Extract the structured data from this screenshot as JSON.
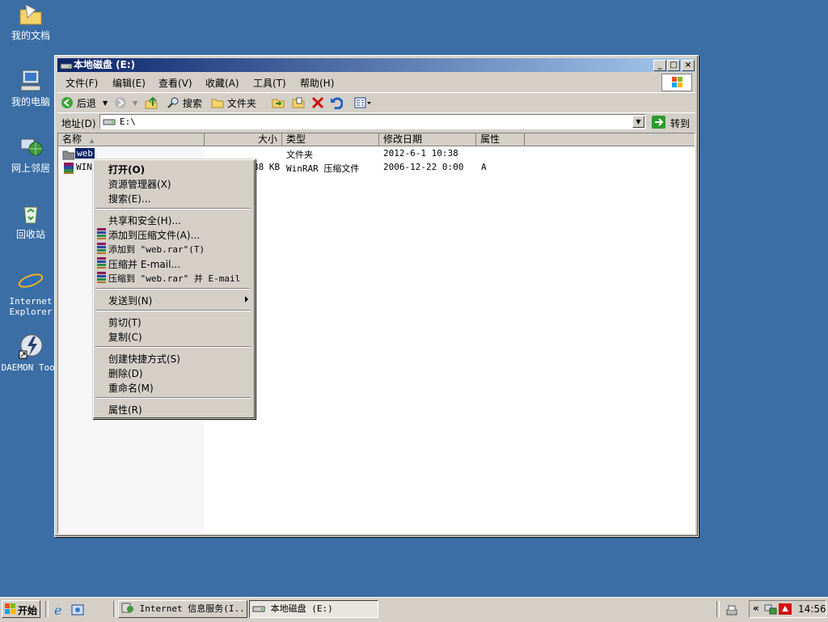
{
  "desktop": {
    "icons": [
      {
        "label": "我的文档"
      },
      {
        "label": "我的电脑"
      },
      {
        "label": "网上邻居"
      },
      {
        "label": "回收站"
      },
      {
        "label_line1": "Internet",
        "label_line2": "Explorer"
      },
      {
        "label": "DAEMON Tool"
      }
    ]
  },
  "window": {
    "title": "本地磁盘 (E:)",
    "controls": {
      "minimize": "_",
      "maximize": "□",
      "close": "×"
    },
    "menu": [
      "文件(F)",
      "编辑(E)",
      "查看(V)",
      "收藏(A)",
      "工具(T)",
      "帮助(H)"
    ],
    "toolbar": {
      "back": "后退",
      "search": "搜索",
      "folders": "文件夹"
    },
    "address": {
      "label": "地址(D)",
      "value": "E:\\",
      "go": "转到"
    },
    "columns": {
      "name": "名称",
      "size": "大小",
      "type": "类型",
      "modified": "修改日期",
      "attributes": "属性"
    },
    "files": [
      {
        "name": "web",
        "size": "",
        "type": "文件夹",
        "modified": "2012-6-1 10:38",
        "attributes": ""
      },
      {
        "name": "WIN",
        "size": "88 KB",
        "type": "WinRAR 压缩文件",
        "modified": "2006-12-22 0:00",
        "attributes": "A"
      }
    ]
  },
  "context_menu": {
    "items": [
      {
        "label": "打开(O)"
      },
      {
        "label": "资源管理器(X)"
      },
      {
        "label": "搜索(E)..."
      },
      {
        "label": "共享和安全(H)..."
      },
      {
        "label": "添加到压缩文件(A)..."
      },
      {
        "label": "添加到 \"web.rar\"(T)"
      },
      {
        "label": "压缩并 E-mail..."
      },
      {
        "label": "压缩到 \"web.rar\" 并 E-mail"
      },
      {
        "label": "发送到(N)"
      },
      {
        "label": "剪切(T)"
      },
      {
        "label": "复制(C)"
      },
      {
        "label": "创建快捷方式(S)"
      },
      {
        "label": "删除(D)"
      },
      {
        "label": "重命名(M)"
      },
      {
        "label": "属性(R)"
      }
    ]
  },
  "taskbar": {
    "start": "开始",
    "tasks": [
      {
        "label": "Internet 信息服务(I..."
      },
      {
        "label": "本地磁盘 (E:)"
      }
    ],
    "clock": "14:56",
    "tray_chevron": "«"
  },
  "colors": {
    "desktop": "#3a6ea5",
    "title_active": "#0a246a",
    "face": "#d4d0c8"
  }
}
